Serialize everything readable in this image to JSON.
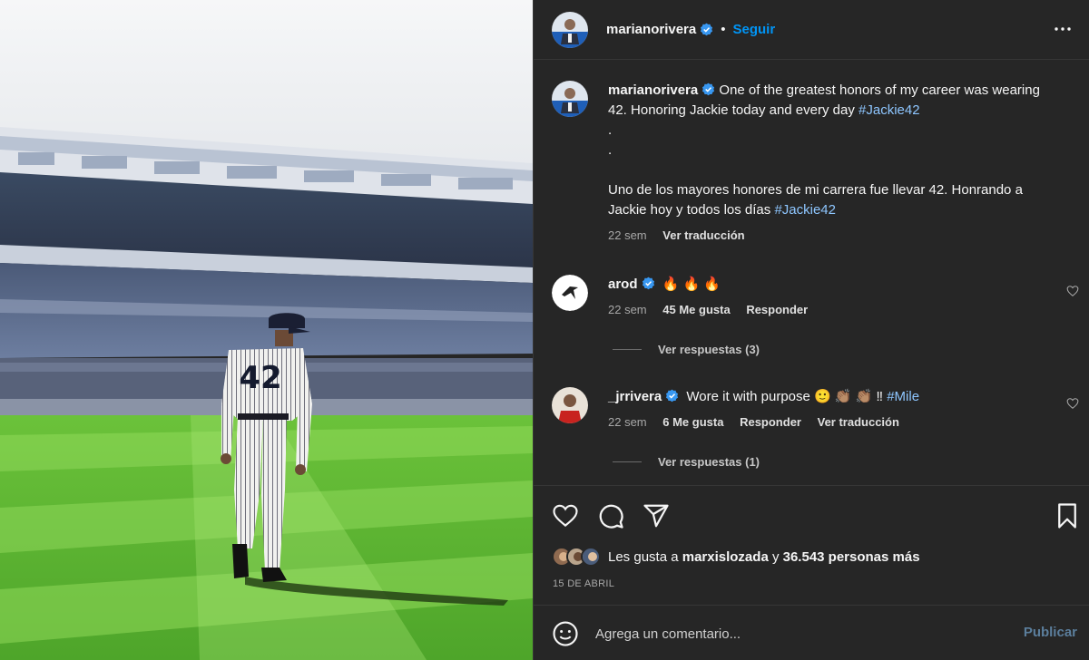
{
  "post": {
    "author": "marianorivera",
    "follow_label": "Seguir",
    "separator": "•",
    "photo_jersey_number": "42"
  },
  "caption": {
    "author": "marianorivera",
    "text_en": "One of the greatest honors of my career was wearing 42. Honoring Jackie today and every day",
    "hashtag_en": "#Jackie42",
    "dot1": ".",
    "dot2": ".",
    "text_es": "Uno de los mayores honores de mi carrera fue llevar 42. Honrando a Jackie hoy y todos los días",
    "hashtag_es": "#Jackie42",
    "time": "22 sem",
    "translate_label": "Ver traducción"
  },
  "comments": [
    {
      "author": "arod",
      "text": "🔥 🔥 🔥",
      "time": "22 sem",
      "likes": "45 Me gusta",
      "reply_label": "Responder",
      "view_replies": "Ver respuestas (3)"
    },
    {
      "author": "_jrrivera",
      "text": "Wore it with purpose 🙂 👏🏽 👏🏽 ‼",
      "hashtag": "#Mile",
      "time": "22 sem",
      "likes": "6 Me gusta",
      "reply_label": "Responder",
      "translate_label": "Ver traducción",
      "view_replies": "Ver respuestas (1)"
    }
  ],
  "engagement": {
    "likes_prefix": "Les gusta a",
    "liker": "marxislozada",
    "likes_joiner": "y",
    "likes_rest": "36.543 personas más",
    "date": "15 DE ABRIL"
  },
  "add_comment": {
    "placeholder": "Agrega un comentario...",
    "publish_label": "Publicar"
  },
  "icons": {
    "verified": "verified-badge-icon",
    "more": "more-options-icon",
    "like": "heart-icon",
    "comment": "comment-bubble-icon",
    "share": "share-paper-plane-icon",
    "save": "bookmark-icon",
    "emoji": "emoji-smiley-icon"
  },
  "colors": {
    "background": "#262626",
    "link_blue": "#0095f6",
    "hashtag": "#8ec6ff",
    "verified": "#3897f0",
    "muted_text": "#a8a8a8"
  }
}
